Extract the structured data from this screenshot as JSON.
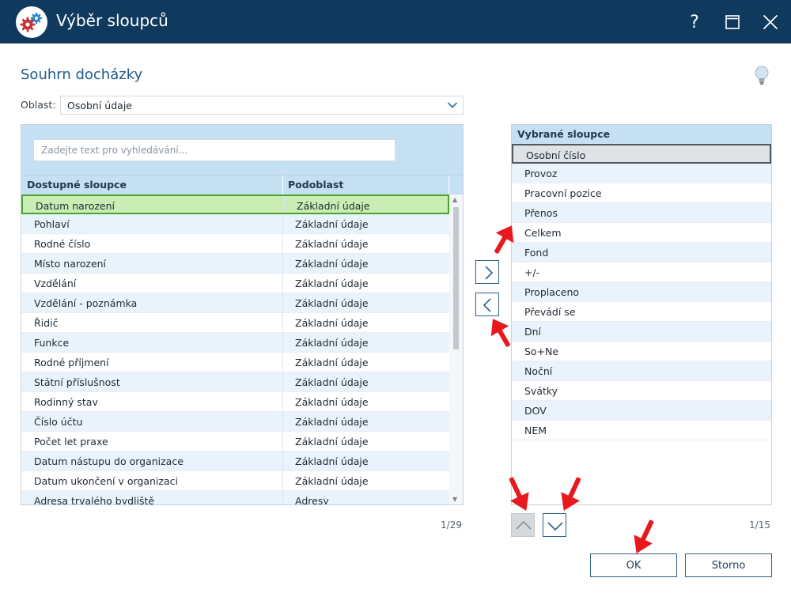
{
  "window": {
    "title": "Výběr sloupců",
    "help_label": "?"
  },
  "section": {
    "title": "Souhrn docházky"
  },
  "oblast": {
    "label": "Oblast:",
    "value": "Osobní údaje"
  },
  "search": {
    "placeholder": "Zadejte text pro vyhledávání..."
  },
  "available": {
    "headers": [
      "Dostupné sloupce",
      "Podoblast"
    ],
    "rows": [
      {
        "name": "Datum narození",
        "sub": "Základní údaje"
      },
      {
        "name": "Pohlaví",
        "sub": "Základní údaje"
      },
      {
        "name": "Rodné číslo",
        "sub": "Základní údaje"
      },
      {
        "name": "Místo narození",
        "sub": "Základní údaje"
      },
      {
        "name": "Vzdělání",
        "sub": "Základní údaje"
      },
      {
        "name": "Vzdělání - poznámka",
        "sub": "Základní údaje"
      },
      {
        "name": "Řidič",
        "sub": "Základní údaje"
      },
      {
        "name": "Funkce",
        "sub": "Základní údaje"
      },
      {
        "name": "Rodné příjmení",
        "sub": "Základní údaje"
      },
      {
        "name": "Státní příslušnost",
        "sub": "Základní údaje"
      },
      {
        "name": "Rodinný stav",
        "sub": "Základní údaje"
      },
      {
        "name": "Číslo účtu",
        "sub": "Základní údaje"
      },
      {
        "name": "Počet let praxe",
        "sub": "Základní údaje"
      },
      {
        "name": "Datum nástupu do organizace",
        "sub": "Základní údaje"
      },
      {
        "name": "Datum ukončení v organizaci",
        "sub": "Základní údaje"
      },
      {
        "name": "Adresa trvalého bydliště",
        "sub": "Adresy"
      }
    ],
    "selected_index": 0,
    "count": "1/29"
  },
  "chosen": {
    "header": "Vybrané sloupce",
    "rows": [
      "Osobní číslo",
      "Provoz",
      "Pracovní pozice",
      "Přenos",
      "Celkem",
      "Fond",
      "+/-",
      "Proplaceno",
      "Převádí se",
      "Dní",
      "So+Ne",
      "Noční",
      "Svátky",
      "DOV",
      "NEM"
    ],
    "selected_index": 0,
    "count": "1/15"
  },
  "buttons": {
    "ok": "OK",
    "cancel": "Storno"
  },
  "colors": {
    "titlebar": "#0f3a5e",
    "accent": "#1e5b8c",
    "header_band": "#c6e0f3",
    "selected_green": "#c9edb2",
    "annotation_arrow": "#e8191e"
  },
  "icons": {
    "app": "gears-icon",
    "help": "question-icon",
    "maximize": "maximize-icon",
    "close": "close-icon",
    "tip": "lightbulb-icon",
    "dropdown": "chevron-down-icon",
    "move_right": "chevron-right-icon",
    "move_left": "chevron-left-icon",
    "move_up": "chevron-up-icon",
    "move_down": "chevron-down-icon",
    "annotation": "red-arrow-icon"
  }
}
